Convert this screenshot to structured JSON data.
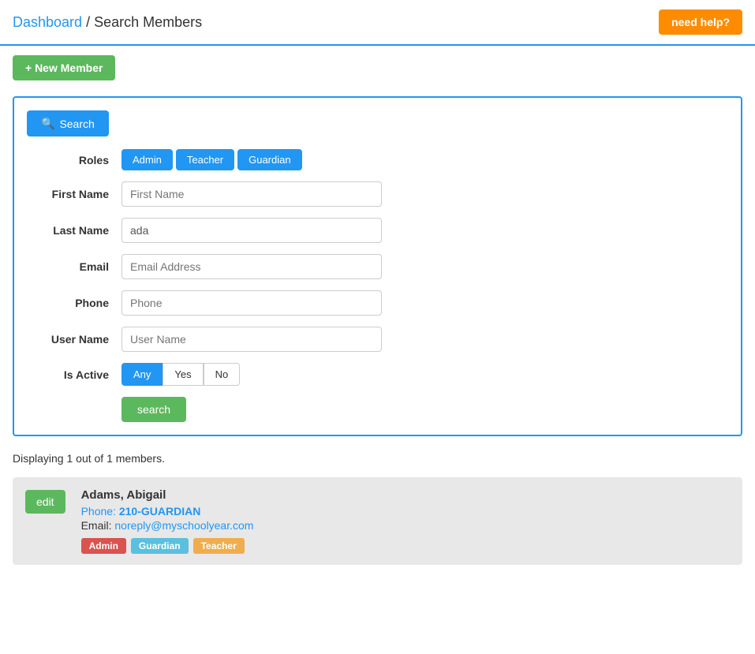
{
  "header": {
    "breadcrumb_link": "Dashboard",
    "breadcrumb_separator": " / ",
    "breadcrumb_current": "Search Members",
    "help_button_label": "need help?"
  },
  "toolbar": {
    "new_member_label": "+ New Member"
  },
  "search_panel": {
    "search_header_label": "Search",
    "roles_label": "Roles",
    "roles": [
      "Admin",
      "Teacher",
      "Guardian"
    ],
    "first_name_label": "First Name",
    "first_name_placeholder": "First Name",
    "first_name_value": "",
    "last_name_label": "Last Name",
    "last_name_placeholder": "",
    "last_name_value": "ada",
    "email_label": "Email",
    "email_placeholder": "Email Address",
    "email_value": "",
    "phone_label": "Phone",
    "phone_placeholder": "Phone",
    "phone_value": "",
    "username_label": "User Name",
    "username_placeholder": "User Name",
    "username_value": "",
    "is_active_label": "Is Active",
    "is_active_options": [
      "Any",
      "Yes",
      "No"
    ],
    "is_active_selected": "Any",
    "search_button_label": "search"
  },
  "results": {
    "display_text": "Displaying 1 out of 1 members."
  },
  "members": [
    {
      "edit_label": "edit",
      "name": "Adams, Abigail",
      "phone_label": "Phone:",
      "phone_value": "210-GUARDIAN",
      "email_label": "Email:",
      "email_value": "noreply@myschoolyear.com",
      "roles": [
        {
          "label": "Admin",
          "type": "admin"
        },
        {
          "label": "Guardian",
          "type": "guardian"
        },
        {
          "label": "Teacher",
          "type": "teacher"
        }
      ]
    }
  ]
}
